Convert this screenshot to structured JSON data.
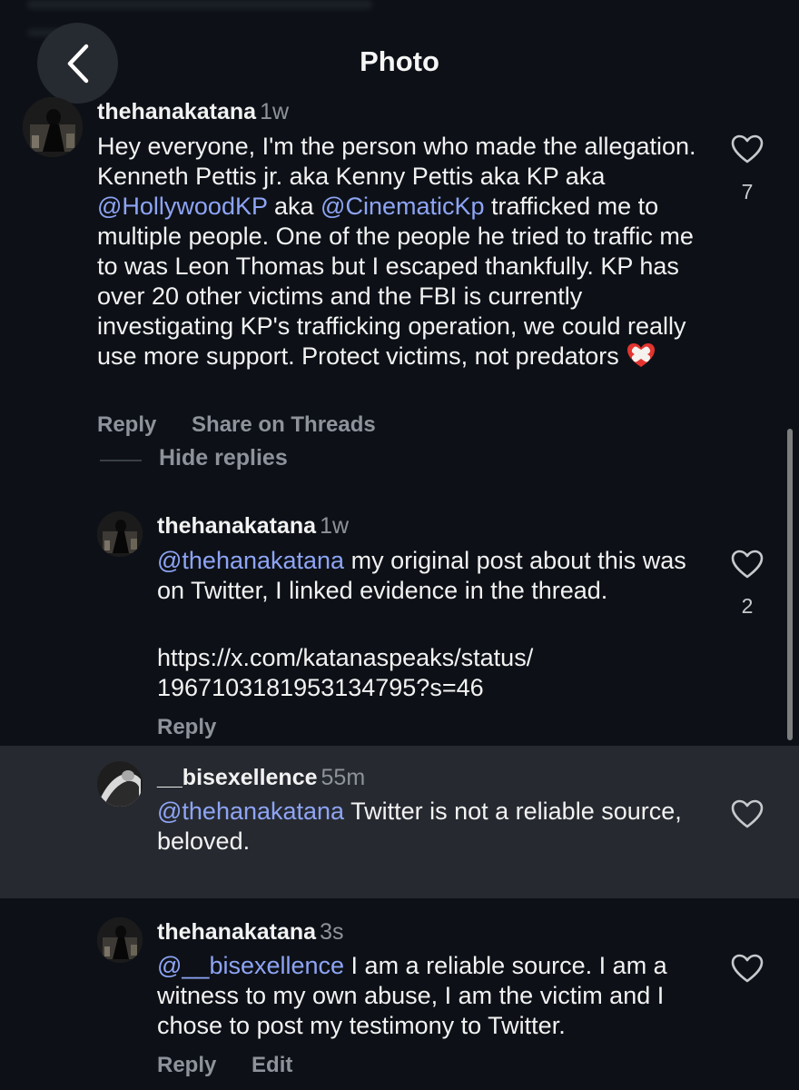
{
  "header": {
    "title": "Photo"
  },
  "comments": [
    {
      "username": "thehanakatana",
      "time": "1w",
      "segments": [
        {
          "t": "Hey everyone, I'm the person who made the allegation. Kenneth Pettis jr. aka Kenny Pettis aka KP aka "
        },
        {
          "t": "@HollywoodKP",
          "mention": true
        },
        {
          "t": " aka "
        },
        {
          "t": "@CinematicKp",
          "mention": true
        },
        {
          "t": " trafficked me to multiple people. One of the people he tried to traffic me to was Leon Thomas but I escaped thankfully. KP has over 20 other victims and the FBI is currently investigating KP's trafficking operation, we could really use more support. Protect victims, not predators "
        }
      ],
      "emoji": "heart-with-bandage",
      "likes": "7",
      "actions": [
        "Reply",
        "Share on Threads"
      ]
    }
  ],
  "hide_replies": "Hide replies",
  "replies": [
    {
      "username": "thehanakatana",
      "time": "1w",
      "segments": [
        {
          "t": "@thehanakatana",
          "mention": true
        },
        {
          "t": " my original post about this was on Twitter, I linked evidence in the thread."
        }
      ],
      "link_lines": [
        "https://x.com/katanaspeaks/status/",
        "1967103181953134795?s=46"
      ],
      "likes": "2",
      "actions": [
        "Reply"
      ]
    },
    {
      "username": "__bisexellence",
      "time": "55m",
      "segments": [
        {
          "t": "@thehanakatana",
          "mention": true
        },
        {
          "t": " Twitter is not a reliable source, beloved."
        }
      ],
      "likes": "",
      "actions": []
    },
    {
      "username": "thehanakatana",
      "time": "3s",
      "segments": [
        {
          "t": "@__bisexellence",
          "mention": true
        },
        {
          "t": " I am a reliable source. I am a witness to my own abuse, I am the victim and I chose to post my testimony to Twitter."
        }
      ],
      "likes": "",
      "actions": [
        "Reply",
        "Edit"
      ]
    }
  ],
  "colors": {
    "background": "#0d1117",
    "mention": "#8ea4f5",
    "secondary": "#8e929a",
    "highlight": "#262a30"
  }
}
